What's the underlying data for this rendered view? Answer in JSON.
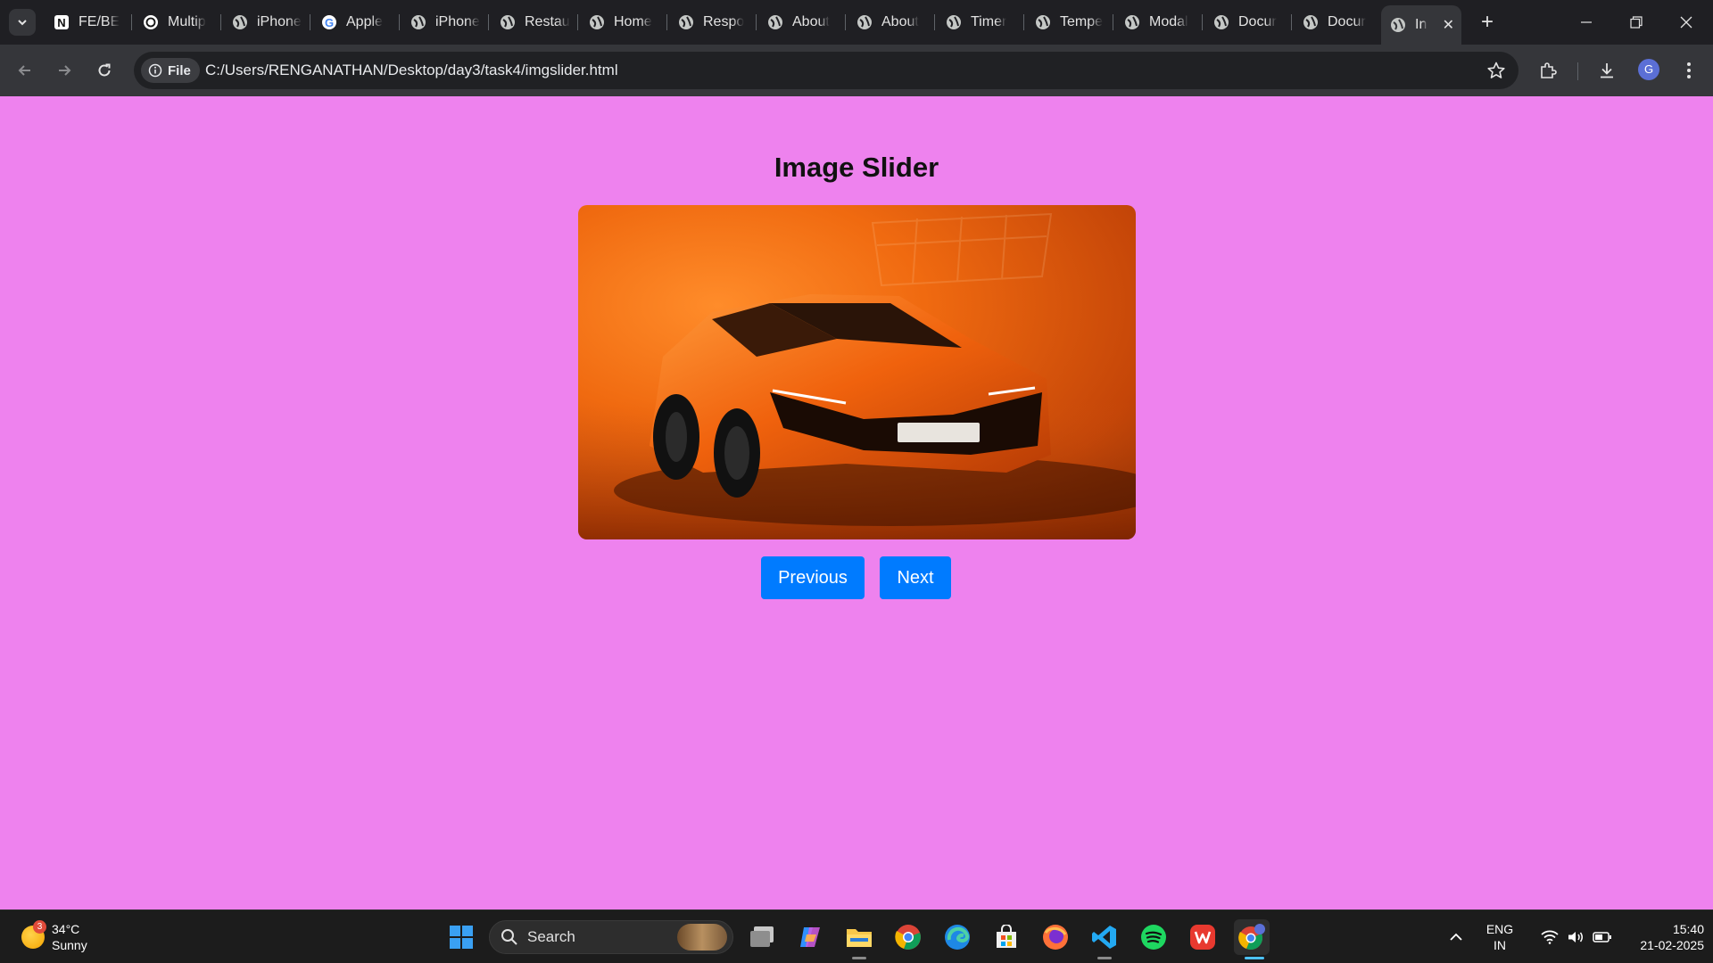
{
  "browser": {
    "tabs": [
      {
        "label": "FE/BE",
        "icon": "notion-icon"
      },
      {
        "label": "Multip",
        "icon": "chatgpt-icon"
      },
      {
        "label": "iPhone",
        "icon": "globe-icon"
      },
      {
        "label": "Apple",
        "icon": "google-icon"
      },
      {
        "label": "iPhone",
        "icon": "globe-icon"
      },
      {
        "label": "Restau",
        "icon": "globe-icon"
      },
      {
        "label": "Home",
        "icon": "globe-icon"
      },
      {
        "label": "Respo",
        "icon": "globe-icon"
      },
      {
        "label": "About",
        "icon": "globe-icon"
      },
      {
        "label": "About",
        "icon": "globe-icon"
      },
      {
        "label": "Timer",
        "icon": "globe-icon"
      },
      {
        "label": "Tempe",
        "icon": "globe-icon"
      },
      {
        "label": "Modal",
        "icon": "globe-icon"
      },
      {
        "label": "Docur",
        "icon": "globe-icon"
      },
      {
        "label": "Docur",
        "icon": "globe-icon"
      },
      {
        "label": "In",
        "icon": "globe-icon",
        "active": true
      }
    ],
    "address": {
      "chip_label": "File",
      "url": "C:/Users/RENGANATHAN/Desktop/day3/task4/imgslider.html"
    },
    "profile_initial": "G"
  },
  "page": {
    "title": "Image Slider",
    "previous_label": "Previous",
    "next_label": "Next",
    "image_subject": "orange sports car"
  },
  "taskbar": {
    "weather": {
      "temp": "34°C",
      "condition": "Sunny",
      "badge": "3"
    },
    "search_placeholder": "Search",
    "apps": [
      "file-explorer-icon",
      "copilot-icon",
      "folder-icon",
      "chrome-icon",
      "edge-icon",
      "store-icon",
      "firefox-icon",
      "vscode-icon",
      "spotify-icon",
      "wps-icon",
      "chrome-profile-icon"
    ],
    "language": {
      "line1": "ENG",
      "line2": "IN"
    },
    "clock": {
      "time": "15:40",
      "date": "21-02-2025"
    }
  },
  "colors": {
    "page_background": "#ee82ee",
    "button_background": "#007bff",
    "chrome_dark": "#1f1f23"
  }
}
